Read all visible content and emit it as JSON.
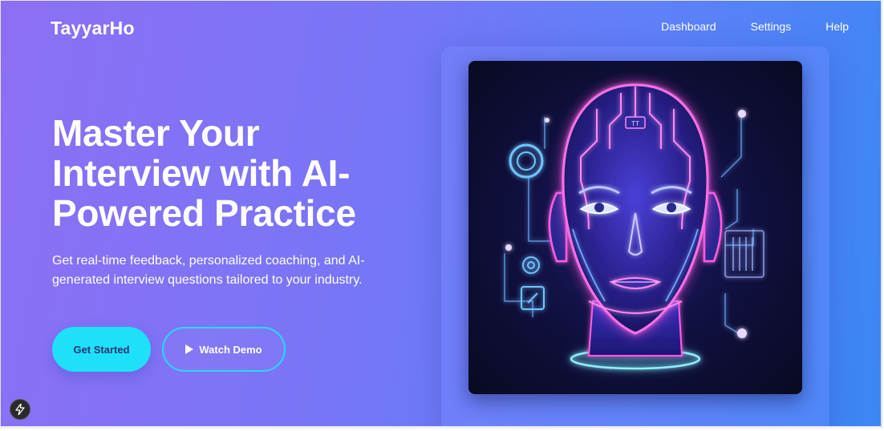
{
  "brand": {
    "name": "TayyarHo"
  },
  "nav": {
    "items": [
      {
        "label": "Dashboard"
      },
      {
        "label": "Settings"
      },
      {
        "label": "Help"
      }
    ]
  },
  "hero": {
    "headline": "Master Your Interview with AI-Powered Practice",
    "subtext": "Get real-time feedback, personalized coaching, and AI-generated interview questions tailored to your industry.",
    "primary_cta": "Get Started",
    "secondary_cta": "Watch Demo"
  },
  "illustration": {
    "icon": "ai-robot-head",
    "chip_text": "TT"
  },
  "colors": {
    "gradient_start": "#8d6ff5",
    "gradient_end": "#3b87f5",
    "primary_button": "#1fe0fb",
    "primary_button_text": "#25356b",
    "neon_pink": "#ff4fd8",
    "neon_cyan": "#4fd7ff"
  },
  "floating_tool": {
    "icon": "lightning-bolt-icon"
  }
}
